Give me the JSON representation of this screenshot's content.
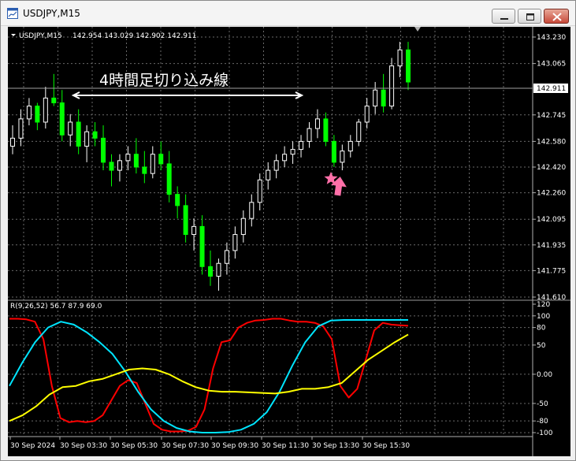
{
  "window": {
    "title": "USDJPY,M15",
    "buttons": {
      "minimize": "minimize",
      "maximize": "maximize",
      "close": "close"
    }
  },
  "chart_data": [
    {
      "type": "candlestick",
      "symbol_label": "USDJPY,M15",
      "ohlc_readout": "142.954 143.029 142.902 142.911",
      "current_price": "142.911",
      "y_ticks": [
        "143.230",
        "143.065",
        "142.745",
        "142.580",
        "142.420",
        "142.260",
        "142.095",
        "141.935",
        "141.775",
        "141.610"
      ],
      "ylim": [
        141.61,
        143.23
      ],
      "annotation": "4時間足切り込み線",
      "up_color": "#ffffff",
      "down_color": "#00ff00",
      "candles": [
        [
          142.55,
          142.68,
          142.5,
          142.6
        ],
        [
          142.6,
          142.78,
          142.55,
          142.72
        ],
        [
          142.72,
          142.85,
          142.68,
          142.8
        ],
        [
          142.8,
          142.82,
          142.65,
          142.7
        ],
        [
          142.7,
          142.92,
          142.66,
          142.85
        ],
        [
          142.85,
          143.0,
          142.8,
          142.82
        ],
        [
          142.82,
          142.9,
          142.58,
          142.62
        ],
        [
          142.62,
          142.75,
          142.55,
          142.7
        ],
        [
          142.7,
          142.78,
          142.5,
          142.55
        ],
        [
          142.55,
          142.68,
          142.45,
          142.64
        ],
        [
          142.64,
          142.7,
          142.55,
          142.6
        ],
        [
          142.6,
          142.68,
          142.4,
          142.45
        ],
        [
          142.45,
          142.5,
          142.3,
          142.4
        ],
        [
          142.4,
          142.5,
          142.33,
          142.46
        ],
        [
          142.46,
          142.55,
          142.4,
          142.5
        ],
        [
          142.5,
          142.6,
          142.38,
          142.42
        ],
        [
          142.42,
          142.52,
          142.32,
          142.38
        ],
        [
          142.38,
          142.55,
          142.35,
          142.5
        ],
        [
          142.5,
          142.58,
          142.4,
          142.44
        ],
        [
          142.44,
          142.52,
          142.2,
          142.25
        ],
        [
          142.25,
          142.3,
          142.1,
          142.18
        ],
        [
          142.18,
          142.25,
          141.95,
          142.0
        ],
        [
          142.0,
          142.1,
          141.9,
          142.05
        ],
        [
          142.05,
          142.12,
          141.75,
          141.8
        ],
        [
          141.8,
          141.9,
          141.68,
          141.74
        ],
        [
          141.74,
          141.85,
          141.65,
          141.82
        ],
        [
          141.82,
          141.95,
          141.75,
          141.9
        ],
        [
          141.9,
          142.05,
          141.85,
          142.0
        ],
        [
          142.0,
          142.15,
          141.95,
          142.1
        ],
        [
          142.1,
          142.25,
          142.05,
          142.2
        ],
        [
          142.2,
          142.38,
          142.15,
          142.34
        ],
        [
          142.34,
          142.45,
          142.28,
          142.4
        ],
        [
          142.4,
          142.5,
          142.35,
          142.46
        ],
        [
          142.46,
          142.55,
          142.42,
          142.5
        ],
        [
          142.5,
          142.58,
          142.44,
          142.53
        ],
        [
          142.53,
          142.62,
          142.48,
          142.58
        ],
        [
          142.58,
          142.7,
          142.54,
          142.66
        ],
        [
          142.66,
          142.78,
          142.6,
          142.72
        ],
        [
          142.72,
          142.76,
          142.55,
          142.58
        ],
        [
          142.58,
          142.62,
          142.42,
          142.45
        ],
        [
          142.45,
          142.56,
          142.4,
          142.52
        ],
        [
          142.52,
          142.62,
          142.48,
          142.58
        ],
        [
          142.58,
          142.72,
          142.55,
          142.7
        ],
        [
          142.7,
          142.85,
          142.66,
          142.8
        ],
        [
          142.8,
          142.95,
          142.75,
          142.9
        ],
        [
          142.9,
          143.0,
          142.76,
          142.8
        ],
        [
          142.8,
          143.1,
          142.78,
          143.05
        ],
        [
          143.05,
          143.2,
          142.98,
          143.15
        ],
        [
          143.15,
          143.2,
          142.9,
          142.95
        ]
      ]
    },
    {
      "type": "line",
      "label": "R(9,26,52) 56.7 87.9 69.0",
      "y_ticks": [
        "120",
        "100",
        "80",
        "50",
        "0.00",
        "-50",
        "-80",
        "-100"
      ],
      "ylim": [
        -100,
        120
      ],
      "x_ticks": [
        "30 Sep 2024",
        "30 Sep 03:30",
        "30 Sep 05:30",
        "30 Sep 07:30",
        "30 Sep 09:30",
        "30 Sep 11:30",
        "30 Sep 13:30",
        "30 Sep 15:30"
      ],
      "series": [
        {
          "color": "#ff0000",
          "values": [
            95,
            95,
            94,
            90,
            60,
            -20,
            -75,
            -82,
            -80,
            -82,
            -80,
            -70,
            -45,
            -20,
            -10,
            -15,
            -50,
            -85,
            -95,
            -98,
            -98,
            -97,
            -90,
            -60,
            10,
            55,
            58,
            80,
            88,
            92,
            93,
            95,
            95,
            92,
            90,
            90,
            88,
            82,
            60,
            -20,
            -40,
            -25,
            25,
            75,
            88,
            85,
            84,
            83
          ]
        },
        {
          "color": "#00e5ff",
          "values": [
            -20,
            20,
            55,
            80,
            90,
            85,
            72,
            55,
            35,
            5,
            -30,
            -60,
            -80,
            -92,
            -98,
            -100,
            -100,
            -99,
            -95,
            -85,
            -65,
            -30,
            15,
            55,
            82,
            92,
            93,
            93,
            93,
            93,
            93,
            93
          ]
        },
        {
          "color": "#ffff00",
          "values": [
            -80,
            -70,
            -55,
            -35,
            -22,
            -20,
            -12,
            -8,
            0,
            8,
            10,
            8,
            0,
            -12,
            -22,
            -28,
            -30,
            -30,
            -31,
            -32,
            -33,
            -30,
            -25,
            -25,
            -22,
            -15,
            5,
            25,
            40,
            55,
            68
          ]
        }
      ]
    }
  ],
  "colors": {
    "background": "#000000",
    "grid": "#707070",
    "arrow": "#ff6fa8"
  },
  "icons": {
    "title_icon": "chart-window-icon",
    "marker": "pink-star-icon",
    "arrow": "pink-up-arrow-icon"
  }
}
